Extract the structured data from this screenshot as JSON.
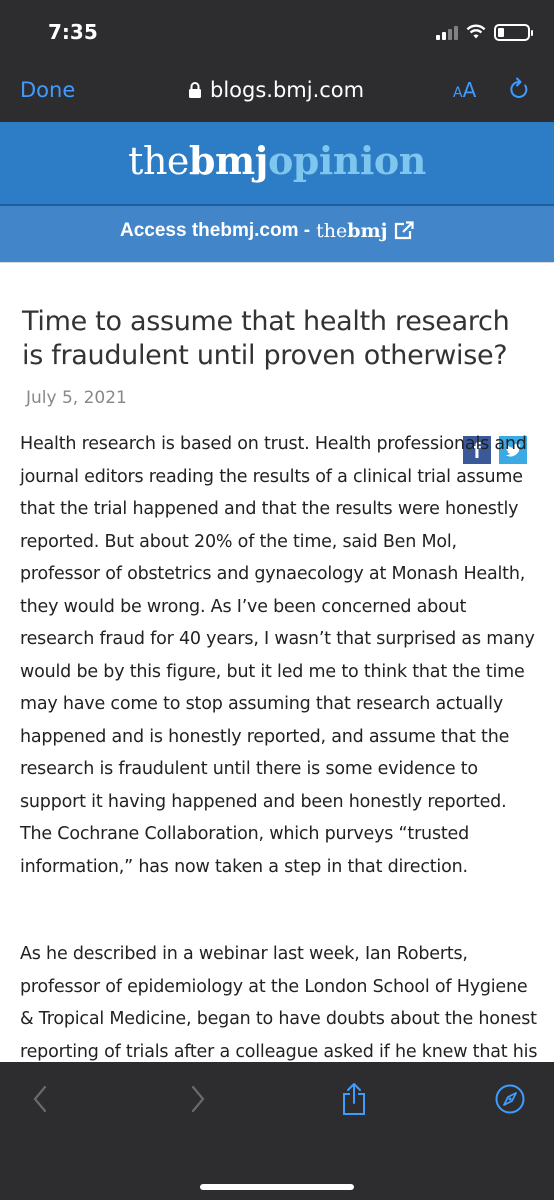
{
  "status": {
    "time": "7:35"
  },
  "browser": {
    "done_label": "Done",
    "url": "blogs.bmj.com",
    "aa_label_small": "A",
    "aa_label_large": "A"
  },
  "site": {
    "logo_the": "the",
    "logo_bmj": "bmj",
    "logo_opinion": "opinion",
    "access_text": "Access thebmj.com -",
    "access_brand_the": "the",
    "access_brand_bmj": "bmj"
  },
  "article": {
    "title": "Time to assume that health research is fraudulent until proven otherwise?",
    "date": "July 5, 2021",
    "paragraphs": [
      "Health research is based on trust. Health professionals and journal editors reading the results of a clinical trial assume that the trial happened and that the results were honestly reported. But about 20% of the time, said Ben Mol, professor of obstetrics and gynaecology at Monash Health, they would be wrong. As I’ve been concerned about research fraud for 40 years, I wasn’t that surprised as many would be by this figure, but it led me to think that the time may have come to stop assuming that research actually happened and is honestly reported, and assume that the research is fraudulent until there is some evidence to support it having happened and been honestly reported. The Cochrane Collaboration, which purveys “trusted information,” has now taken a step in that direction.",
      "As he described in a webinar last week, Ian Roberts, professor of epidemiology at the London School of Hygiene & Tropical Medicine, began to have doubts about the honest reporting of trials after a colleague asked if he knew that his systematic review showing the mannitol"
    ]
  },
  "share": {
    "facebook": "f"
  },
  "icons": [
    "lock-icon",
    "reload-icon",
    "external-link-icon",
    "facebook-icon",
    "twitter-icon",
    "back-icon",
    "forward-icon",
    "share-icon",
    "compass-icon"
  ],
  "colors": {
    "chrome": "#2d2d30",
    "link_blue": "#3f9cff",
    "header_blue": "#2d7cc6",
    "access_blue": "#4286c9",
    "logo_light": "#7fc6ef"
  }
}
